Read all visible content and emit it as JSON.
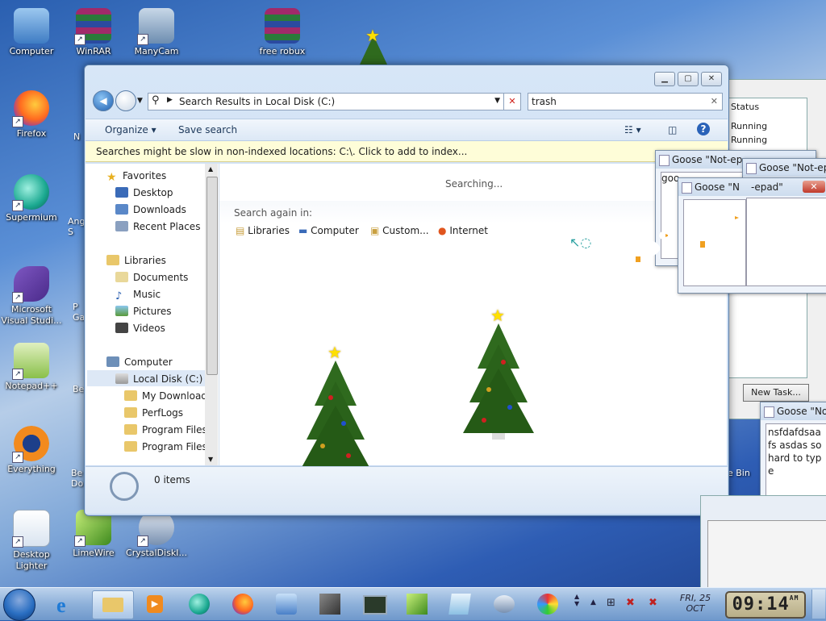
{
  "desktop": {
    "icons": [
      {
        "label": "Computer"
      },
      {
        "label": "WinRAR"
      },
      {
        "label": "ManyCam"
      },
      {
        "label": "free robux"
      },
      {
        "label": "Firefox"
      },
      {
        "label": "Supermium"
      },
      {
        "label": "Microsoft Visual Studi..."
      },
      {
        "label": "Notepad++"
      },
      {
        "label": "Everything"
      },
      {
        "label": "Desktop Lighter"
      },
      {
        "label": "LimeWire"
      },
      {
        "label": "CrystalDiskI..."
      }
    ],
    "partial_labels": [
      "N",
      "Ang S",
      "P Ga",
      "Be",
      "Be Do",
      "e Bin"
    ]
  },
  "explorer": {
    "address": "Search Results in Local Disk (C:)",
    "search_value": "trash",
    "toolbar": {
      "organize": "Organize",
      "save_search": "Save search"
    },
    "infobar": "Searches might be slow in non-indexed locations: C:\\. Click to add to index...",
    "nav": {
      "favorites": "Favorites",
      "favorite_items": [
        "Desktop",
        "Downloads",
        "Recent Places"
      ],
      "libraries": "Libraries",
      "library_items": [
        "Documents",
        "Music",
        "Pictures",
        "Videos"
      ],
      "computer": "Computer",
      "disk": "Local Disk (C:)",
      "disk_items": [
        "My Downloads",
        "PerfLogs",
        "Program Files",
        "Program Files ("
      ]
    },
    "content": {
      "status": "Searching...",
      "search_again": "Search again in:",
      "locations": [
        "Libraries",
        "Computer",
        "Custom...",
        "Internet"
      ]
    },
    "details": {
      "count": "0 items"
    }
  },
  "task_manager": {
    "column": "Status",
    "rows": [
      "Running",
      "Running"
    ],
    "new_task": "New Task..."
  },
  "goose_windows": [
    {
      "title": "Goose \"Not-ep",
      "body": "goo"
    },
    {
      "title": "Goose \"Not-ep",
      "body": ""
    },
    {
      "title": "Goose \"N",
      "body": ""
    },
    {
      "title": "-epad\"",
      "body": ""
    },
    {
      "title": "Goose \"No",
      "body": "nsfdafdsaafs asdas so hard to type"
    }
  ],
  "taskbar": {
    "day": "FRI, 25",
    "month": "OCT",
    "time": "09:14",
    "ampm": "AM"
  }
}
